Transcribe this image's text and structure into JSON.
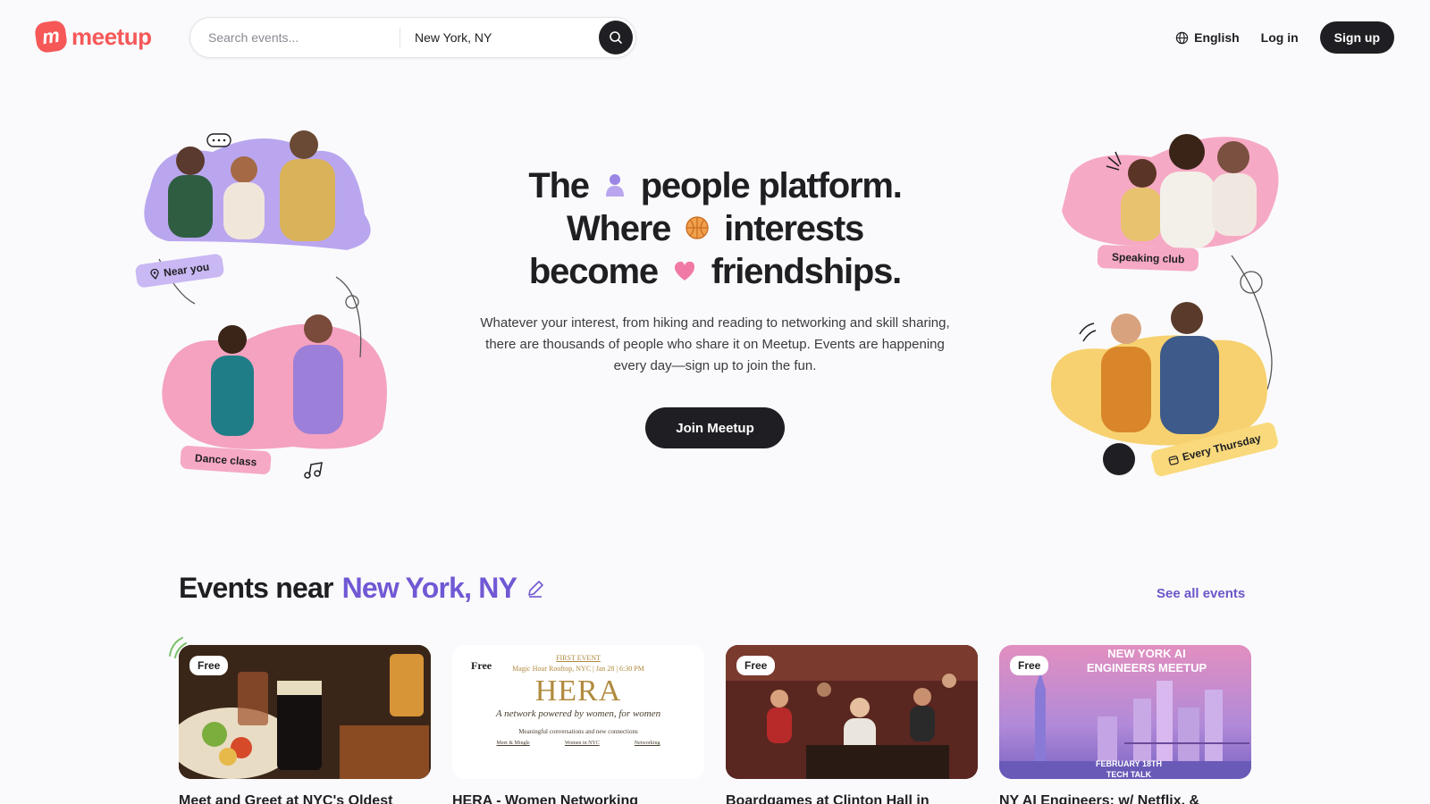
{
  "brand": {
    "logo_text": "meetup",
    "accent": "#f65858"
  },
  "search": {
    "placeholder": "Search events...",
    "location": "New York, NY"
  },
  "nav": {
    "language": "English",
    "login": "Log in",
    "signup": "Sign up"
  },
  "hero": {
    "line1_start": "The",
    "line1_end": "people platform.",
    "line2_start": "Where",
    "line2_end": "interests",
    "line3_start": "become",
    "line3_end": "friendships.",
    "subtitle": "Whatever your interest, from hiking and reading to networking and skill sharing, there are thousands of people who share it on Meetup. Events are happening every day—sign up to join the fun.",
    "cta": "Join Meetup"
  },
  "collage_tags": {
    "near_you": "Near you",
    "dance_class": "Dance class",
    "speaking_club": "Speaking club",
    "every_thursday": "Every Thursday"
  },
  "events": {
    "heading": "Events near",
    "city": "New York, NY",
    "see_all": "See all events",
    "cards": [
      {
        "badge": "Free",
        "title": "Meet and Greet at NYC's Oldest"
      },
      {
        "badge": "Free",
        "title": "HERA - Women Networking",
        "poster_top": "FIRST EVENT",
        "poster_line": "Magic Hour Rooftop, NYC | Jan 28 | 6:30 PM",
        "poster_name": "HERA",
        "poster_tagline": "A network powered by women, for women",
        "poster_sub": "Meaningful conversations and new connections",
        "poster_tags": [
          "Meet & Mingle",
          "Women in NYC",
          "Networking"
        ]
      },
      {
        "badge": "Free",
        "title": "Boardgames at Clinton Hall in"
      },
      {
        "badge": "Free",
        "title": "NY AI Engineers: w/ Netflix, &",
        "poster_title": "NEW YORK AI ENGINEERS MEETUP",
        "poster_date": "FEBRUARY 18TH",
        "poster_sub": "TECH TALK"
      }
    ]
  },
  "colors": {
    "purple": "#7158d4",
    "dark": "#1f1f23",
    "pink": "#f38fb0",
    "yellow": "#f9d97b"
  }
}
